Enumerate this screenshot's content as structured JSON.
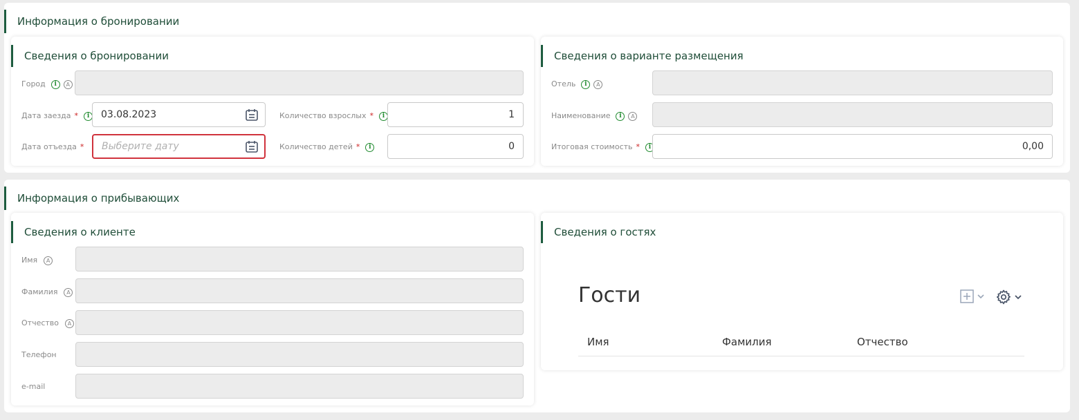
{
  "booking_info": {
    "title": "Информация о бронировании",
    "booking_details": {
      "title": "Сведения о бронировании",
      "city_label": "Город",
      "checkin_label": "Дата заезда",
      "checkin_value": "03.08.2023",
      "checkout_label": "Дата отъезда",
      "checkout_placeholder": "Выберите дату",
      "adults_label": "Количество взрослых",
      "adults_value": "1",
      "children_label": "Количество детей",
      "children_value": "0"
    },
    "accommodation": {
      "title": "Сведения о варианте размещения",
      "hotel_label": "Отель",
      "name_label": "Наименование",
      "total_label": "Итоговая стоимость",
      "total_value": "0,00"
    }
  },
  "arrivals_info": {
    "title": "Информация о прибывающих",
    "client": {
      "title": "Сведения о клиенте",
      "first_name_label": "Имя",
      "last_name_label": "Фамилия",
      "middle_name_label": "Отчество",
      "phone_label": "Телефон",
      "email_label": "e-mail"
    },
    "guests": {
      "title": "Сведения о гостях",
      "grid_title": "Гости",
      "columns": [
        "Имя",
        "Фамилия",
        "Отчество"
      ]
    }
  },
  "required_mark": "*",
  "info_icon_glyph": "i",
  "auto_icon_glyph": "A",
  "colors": {
    "accent": "#1d5c3f",
    "error": "#d0323c",
    "info": "#1f8a2e"
  }
}
